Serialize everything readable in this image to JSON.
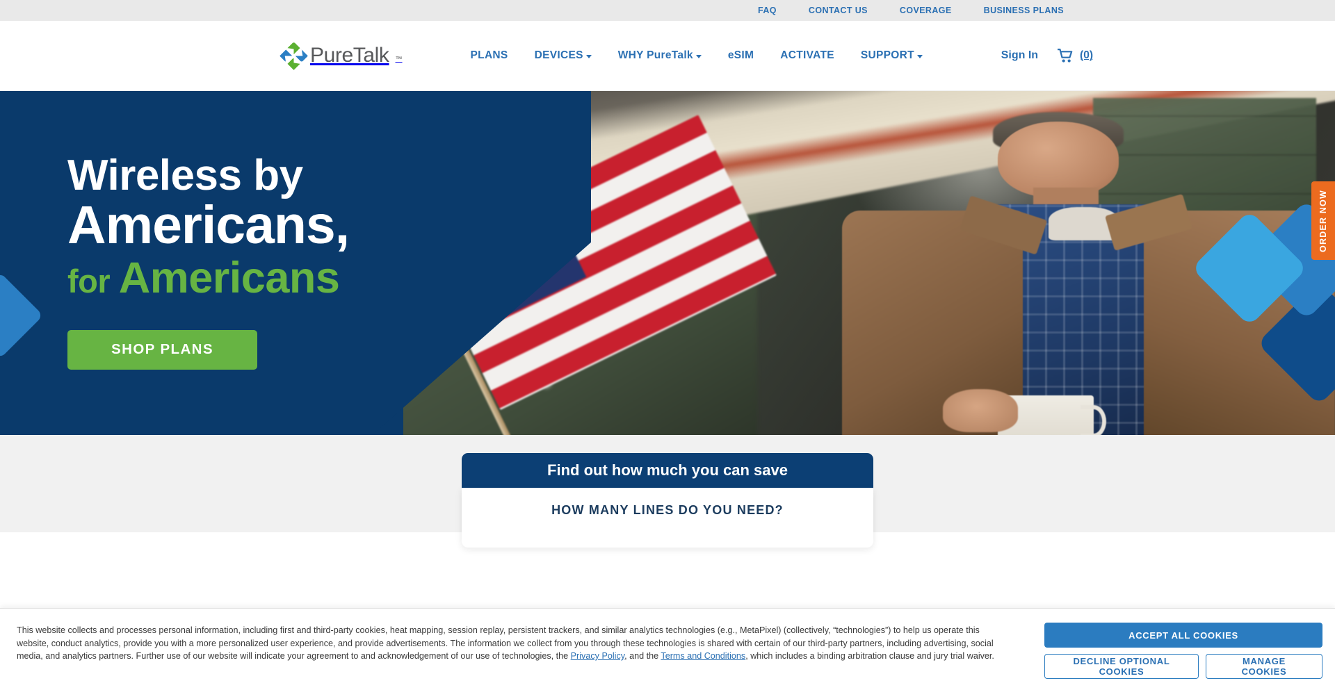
{
  "utility_bar": {
    "links": [
      {
        "label": "FAQ"
      },
      {
        "label": "CONTACT US"
      },
      {
        "label": "COVERAGE"
      },
      {
        "label": "BUSINESS PLANS"
      }
    ]
  },
  "header": {
    "brand": {
      "name": "PureTalk",
      "trademark": "™",
      "logo_icon": "puretalk-diamond-logo"
    },
    "nav": [
      {
        "label": "PLANS",
        "has_dropdown": false
      },
      {
        "label": "DEVICES",
        "has_dropdown": true
      },
      {
        "label": "WHY PureTalk",
        "has_dropdown": true
      },
      {
        "label": "eSIM",
        "has_dropdown": false
      },
      {
        "label": "ACTIVATE",
        "has_dropdown": false
      },
      {
        "label": "SUPPORT",
        "has_dropdown": true
      }
    ],
    "sign_in_label": "Sign In",
    "cart": {
      "icon": "shopping-cart-icon",
      "count_label": "(0)"
    }
  },
  "hero": {
    "headline_line1": "Wireless by",
    "headline_line2": "Americans,",
    "headline_line3_small": "for ",
    "headline_line3_bold": "Americans",
    "cta_label": "SHOP PLANS",
    "order_tab_label": "ORDER NOW",
    "image_alt": "Man in brown jacket and blue plaid shirt holding a coffee mug on a porch with an American flag"
  },
  "save_section": {
    "card_title": "Find out how much you can save",
    "question": "HOW MANY LINES DO YOU NEED?"
  },
  "cookie_banner": {
    "text_part1": "This website collects and processes personal information, including first and third-party cookies, heat mapping, session replay, persistent trackers, and similar analytics technologies (e.g., MetaPixel) (collectively, “technologies”) to help us operate this website, conduct analytics, provide you with a more personalized user experience, and provide advertisements. The information we collect from you through these technologies is shared with certain of our third-party partners, including advertising, social media, and analytics partners. Further use of our website will indicate your agreement to and acknowledgement of our use of technologies, the ",
    "link_privacy": "Privacy Policy",
    "text_part2": ", and the ",
    "link_terms": "Terms and Conditions",
    "text_part3": ", which includes a binding arbitration clause and jury trial waiver.",
    "accept_label": "ACCEPT ALL COOKIES",
    "decline_label": "DECLINE OPTIONAL COOKIES",
    "manage_label": "MANAGE COOKIES"
  },
  "colors": {
    "brand_blue": "#2b70b3",
    "navy": "#0a3a6b",
    "green": "#67b443",
    "orange": "#ec6b1f",
    "light_blue": "#3aa6e0",
    "mid_blue": "#2b7fc4",
    "utility_bg": "#e9e9e9"
  }
}
